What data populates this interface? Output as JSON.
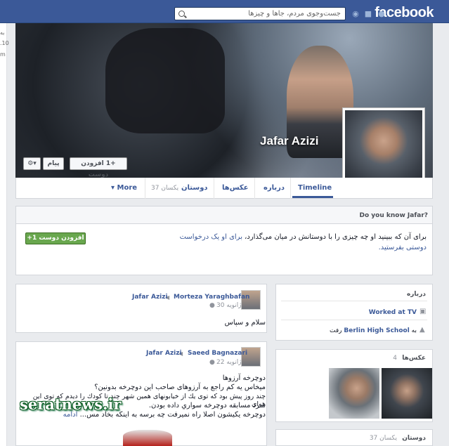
{
  "topbar": {
    "logo": "facebook",
    "search_placeholder": "جست‌وجوی مردم، جاها و چیزها",
    "icons": [
      "friends-icon",
      "messages-icon",
      "notifications-icon",
      "privacy-icon"
    ]
  },
  "left_sliver": [
    "به",
    ".10",
    "m"
  ],
  "cover": {
    "name": "Jafar Azizi",
    "message_button": "پیام",
    "add_friend_button": "افزودن دوست",
    "add_friend_glyph": "+1"
  },
  "tabs": {
    "timeline": "Timeline",
    "about": "درباره",
    "photos": "عکس‌ها",
    "friends": "دوستان",
    "friends_count": "37 یکسان",
    "more": "More"
  },
  "know_box": {
    "title": "Do you know Jafar?",
    "text_before": "برای آن که ببینید او چه چیزی را با دوستانش در میان می‌گذارد، ",
    "text_link": "برای او یک درخواست دوستی بفرستید.",
    "button": "افزودن دوست"
  },
  "posts": [
    {
      "author": "Morteza Yaraghbafan",
      "target": "Jafar Azizi",
      "date": "ژانویه 30",
      "text": "سلام و سپاس"
    },
    {
      "author": "Saeed Bagnazari",
      "target": "Jafar Azizi",
      "date": "ژانویه 22",
      "lines": [
        "دوچرخه آرزوها",
        "میخاس یه کم راجع به آرزوهای صاحب این دوچرخه بدونین؟",
        "چند روز پیش بود که توی یك از خیابونهای همین شهر چند تا کودك را دیدم که توی این هوای",
        "سرد مسابقه دوچرخه سواري داده بودن.",
        "دوچرخه یکیشون اصلا راه نمیرفت چه برسه به اینکه بخاد مس..."
      ],
      "more": "ادامه"
    }
  ],
  "right": {
    "about_title": "درباره",
    "work": "Worked at TV",
    "school_prefix": "به",
    "school": "Berlin High School",
    "school_suffix": "رفت",
    "photos_title": "عکس‌ها",
    "photos_count": "4",
    "friends_title": "دوستان",
    "friends_count": "37 یکسان"
  },
  "watermark": "seratnews.ir",
  "colors": {
    "brand": "#3b5998",
    "button_green": "#69a74e",
    "background": "#e9ebee"
  }
}
